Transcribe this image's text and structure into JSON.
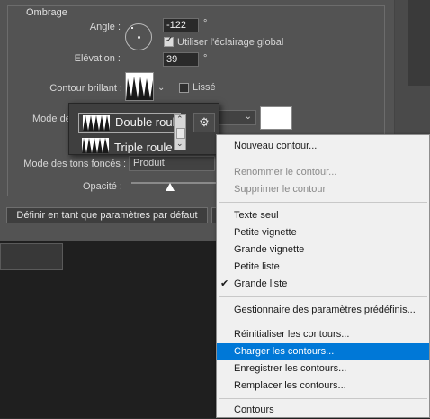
{
  "section_title": "Ombrage",
  "angle": {
    "label": "Angle :",
    "value": "-122",
    "unit": "°"
  },
  "global_light": {
    "label": "Utiliser l'éclairage global",
    "checked": true
  },
  "elevation": {
    "label": "Elévation :",
    "value": "39",
    "unit": "°"
  },
  "contour": {
    "label": "Contour brillant :"
  },
  "smooth": {
    "label": "Lissé",
    "checked": false
  },
  "highlight_mode": {
    "label": "Mode de"
  },
  "shadow_mode": {
    "label": "Mode des tons foncés :",
    "value": "Produit"
  },
  "opacity": {
    "label": "Opacité :",
    "slider_fraction": 0.46
  },
  "buttons": {
    "set_default": "Définir en tant que paramètres par défaut"
  },
  "contour_picker": {
    "items": [
      "Double roul",
      "Triple roule"
    ]
  },
  "colors": {
    "panel": "#535353",
    "menu_bg": "#f0f0f0",
    "highlight": "#0078d7"
  },
  "menu": {
    "new_contour": "Nouveau contour...",
    "rename_contour": "Renommer le contour...",
    "delete_contour": "Supprimer le contour",
    "text_only": "Texte seul",
    "small_thumb": "Petite vignette",
    "large_thumb": "Grande vignette",
    "small_list": "Petite liste",
    "large_list": "Grande liste",
    "large_list_check": "✔",
    "preset_manager": "Gestionnaire des paramètres prédéfinis...",
    "reset_contours": "Réinitialiser les contours...",
    "load_contours": "Charger les contours...",
    "save_contours": "Enregistrer les contours...",
    "replace_contours": "Remplacer les contours...",
    "contours": "Contours"
  }
}
